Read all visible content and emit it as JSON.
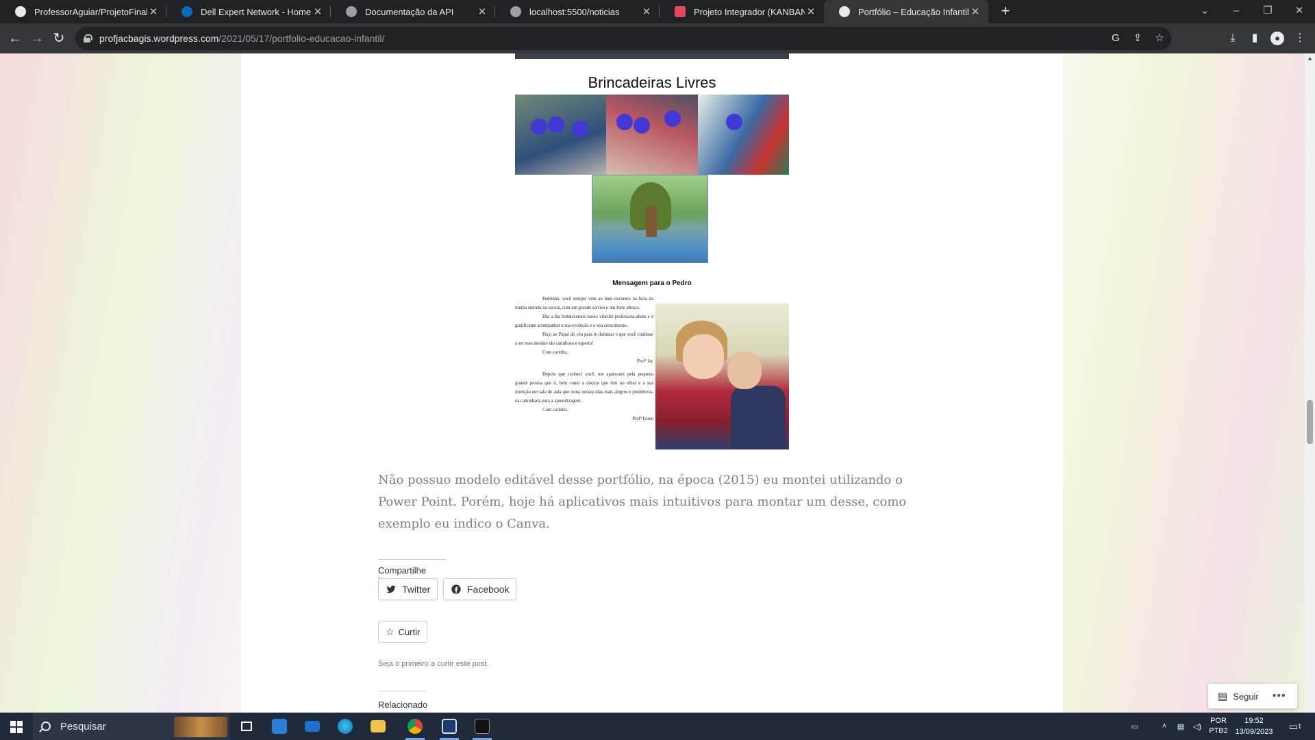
{
  "browser": {
    "tabs": [
      {
        "title": "ProfessorAguiar/ProjetoFinal-NI",
        "favicon": "github-icon"
      },
      {
        "title": "Dell Expert Network - Home",
        "favicon": "dell-icon"
      },
      {
        "title": "Documentação da API",
        "favicon": "globe-icon"
      },
      {
        "title": "localhost:5500/noticias",
        "favicon": "globe-icon"
      },
      {
        "title": "Projeto Integrador (KANBAN) | Tr",
        "favicon": "trello-icon"
      },
      {
        "title": "Portfólio – Educação Infantil – Pro",
        "favicon": "wordpress-icon",
        "active": true
      }
    ],
    "url_host": "profjacbagis.wordpress.com",
    "url_path": "/2021/05/17/portfolio-educacao-infantil/"
  },
  "page": {
    "caption_brincadeiras": "Brincadeiras Livres",
    "message_title": "Mensagem para o Pedro",
    "letter": {
      "p1": "Pedrinho, você sempre vem ao meu encontro na hora da minha entrada na escola, com um grande sorriso e um forte abraço.",
      "p2": "Dia a dia fortalecemos nosso vínculo professora-aluno e é gratificante acompanhar a sua evolução e o seu crescimento.",
      "p3": "Peço ao Papai do céu para te iluminar e que você continue a ser esse menino tão carinhoso e esperto!",
      "closing1": "Com carinho,",
      "sign1": "Profª Jac",
      "p4": "Depois que conheci você, me apaixonei pela pequena grande pessoa que é, bem como a doçura que tem no olhar e a sua intenção em sala de aula que torna nossos dias mais alegres e produtivos, na caminhada para a aprendizagem.",
      "closing2": "Com carinho,",
      "sign2": "Profª Ivone"
    },
    "post_text": "Não possuo modelo editável desse portfólio, na época (2015) eu montei utilizando o Power Point. Porém, hoje há aplicativos mais intuitivos para montar um desse, como exemplo eu indico o Canva.",
    "share_label": "Compartilhe isso:",
    "share_twitter": "Twitter",
    "share_facebook": "Facebook",
    "like_label": "Curtir",
    "like_note": "Seja o primeiro a curtir este post.",
    "related_label": "Relacionado",
    "follow_label": "Seguir",
    "follow_more": "•••"
  },
  "taskbar": {
    "search_placeholder": "Pesquisar",
    "lang_top": "POR",
    "lang_bottom": "PTB2",
    "time": "19:52",
    "date": "13/09/2023",
    "notification_count": "1"
  },
  "colors": {
    "tab_bg": "#202124",
    "toolbar_bg": "#35363a",
    "post_text": "#808080",
    "taskbar_bg": "#1f2a3a"
  }
}
